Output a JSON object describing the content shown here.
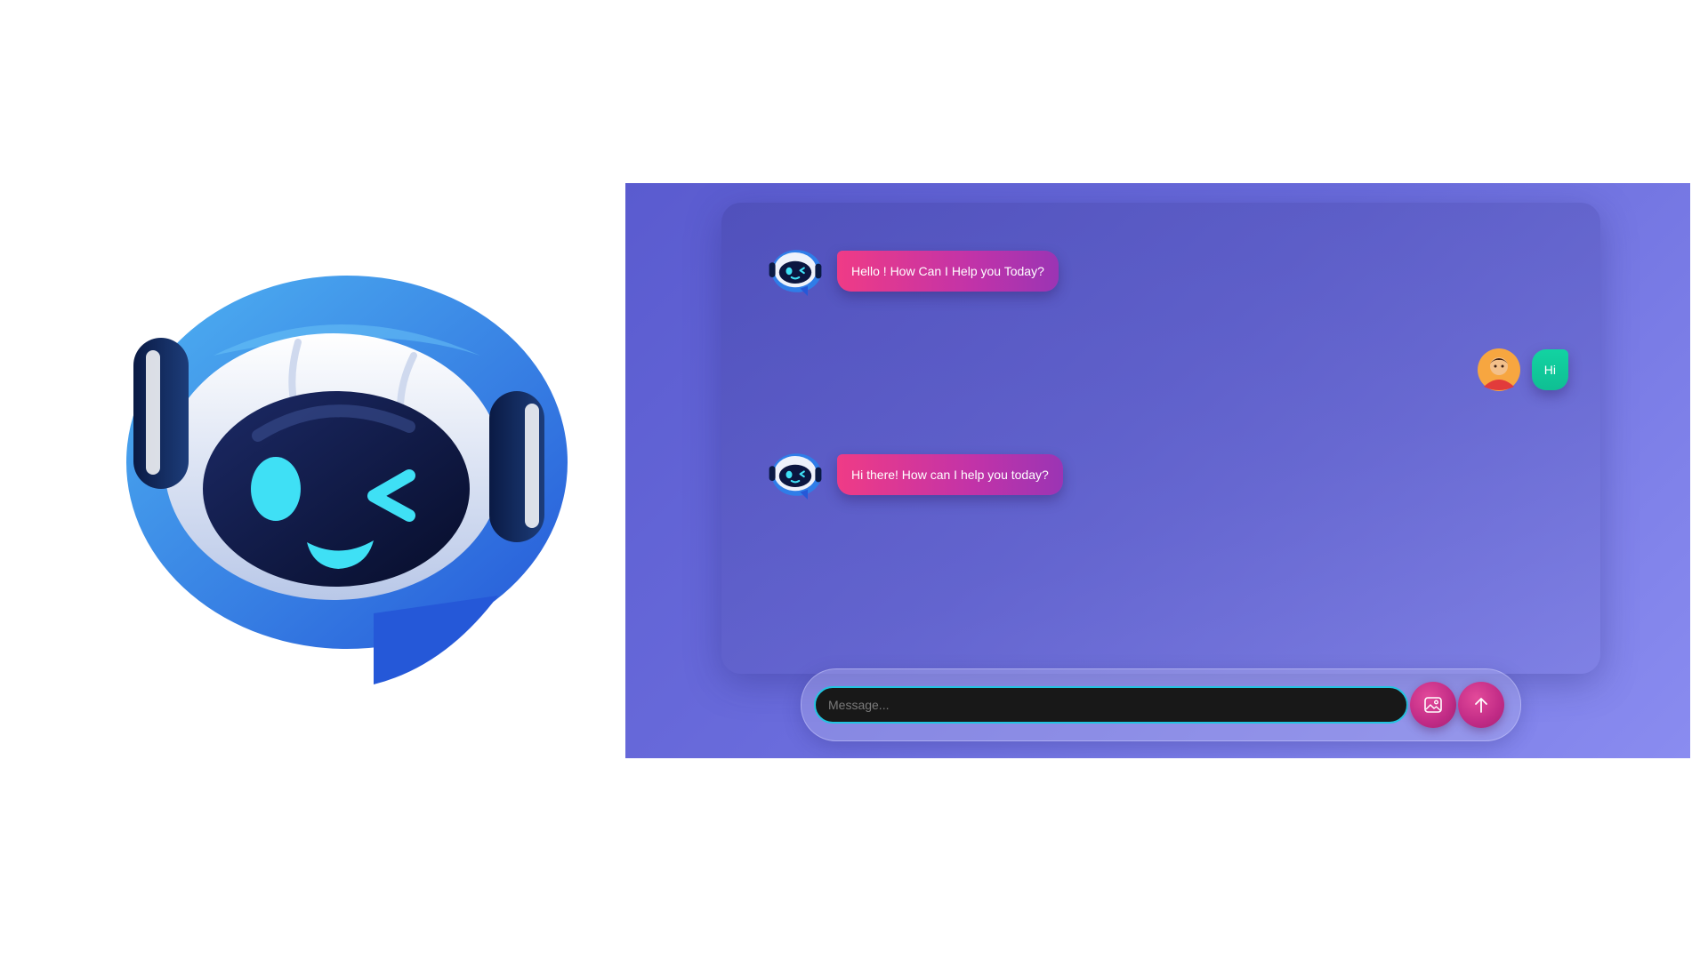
{
  "branding": {
    "logo_icon": "robot-chat-logo-icon",
    "colors": {
      "bubble_blue": "#2f7de8",
      "visor": "#0b1640",
      "eye_glow": "#3fe0f5"
    }
  },
  "chat": {
    "messages": [
      {
        "sender": "bot",
        "avatar_icon": "robot-avatar-icon",
        "text": "Hello ! How Can I Help you Today?"
      },
      {
        "sender": "user",
        "avatar_icon": "user-avatar-icon",
        "text": "Hi"
      },
      {
        "sender": "bot",
        "avatar_icon": "robot-avatar-icon",
        "text": "Hi there! How can I help you today?"
      }
    ]
  },
  "composer": {
    "placeholder": "Message...",
    "value": "",
    "image_button_icon": "image-upload-icon",
    "send_button_icon": "arrow-up-icon"
  },
  "theme": {
    "background_gradient": [
      "#5a5bcf",
      "#8a8cf0"
    ],
    "bot_bubble": [
      "#ef3b86",
      "#9b34b4"
    ],
    "user_bubble": "#12d3a2",
    "input_border": "#22c4e0",
    "button": "#c12b86"
  }
}
